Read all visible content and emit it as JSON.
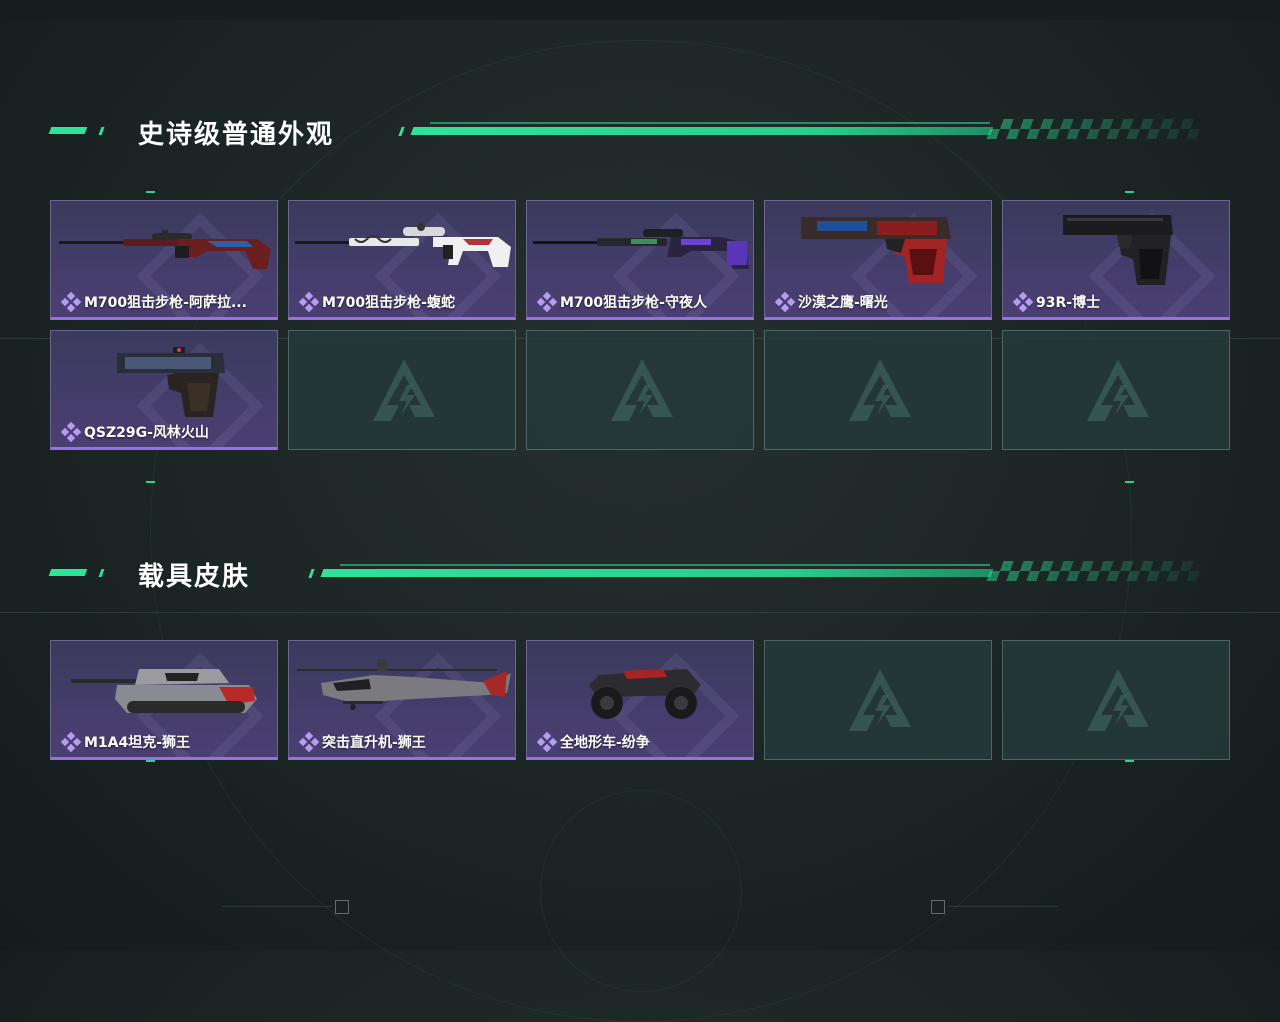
{
  "colors": {
    "accent": "#2fe39a",
    "epic_border": "#9a6ee8",
    "card_bg": "#453d6c",
    "empty_bg": "#243a3a"
  },
  "sections": [
    {
      "title": "史诗级普通外观",
      "items": [
        {
          "name": "M700狙击步枪-阿萨拉...",
          "icon": "sniper-rifle-icon"
        },
        {
          "name": "M700狙击步枪-蝮蛇",
          "icon": "sniper-rifle-icon"
        },
        {
          "name": "M700狙击步枪-守夜人",
          "icon": "sniper-rifle-icon"
        },
        {
          "name": "沙漠之鹰-曙光",
          "icon": "pistol-icon"
        },
        {
          "name": "93R-博士",
          "icon": "pistol-icon"
        },
        {
          "name": "QSZ29G-风林火山",
          "icon": "pistol-icon"
        }
      ],
      "empty_slots": 4
    },
    {
      "title": "载具皮肤",
      "items": [
        {
          "name": "M1A4坦克-狮王",
          "icon": "tank-icon"
        },
        {
          "name": "突击直升机-狮王",
          "icon": "helicopter-icon"
        },
        {
          "name": "全地形车-纷争",
          "icon": "atv-icon"
        }
      ],
      "empty_slots": 2
    }
  ]
}
